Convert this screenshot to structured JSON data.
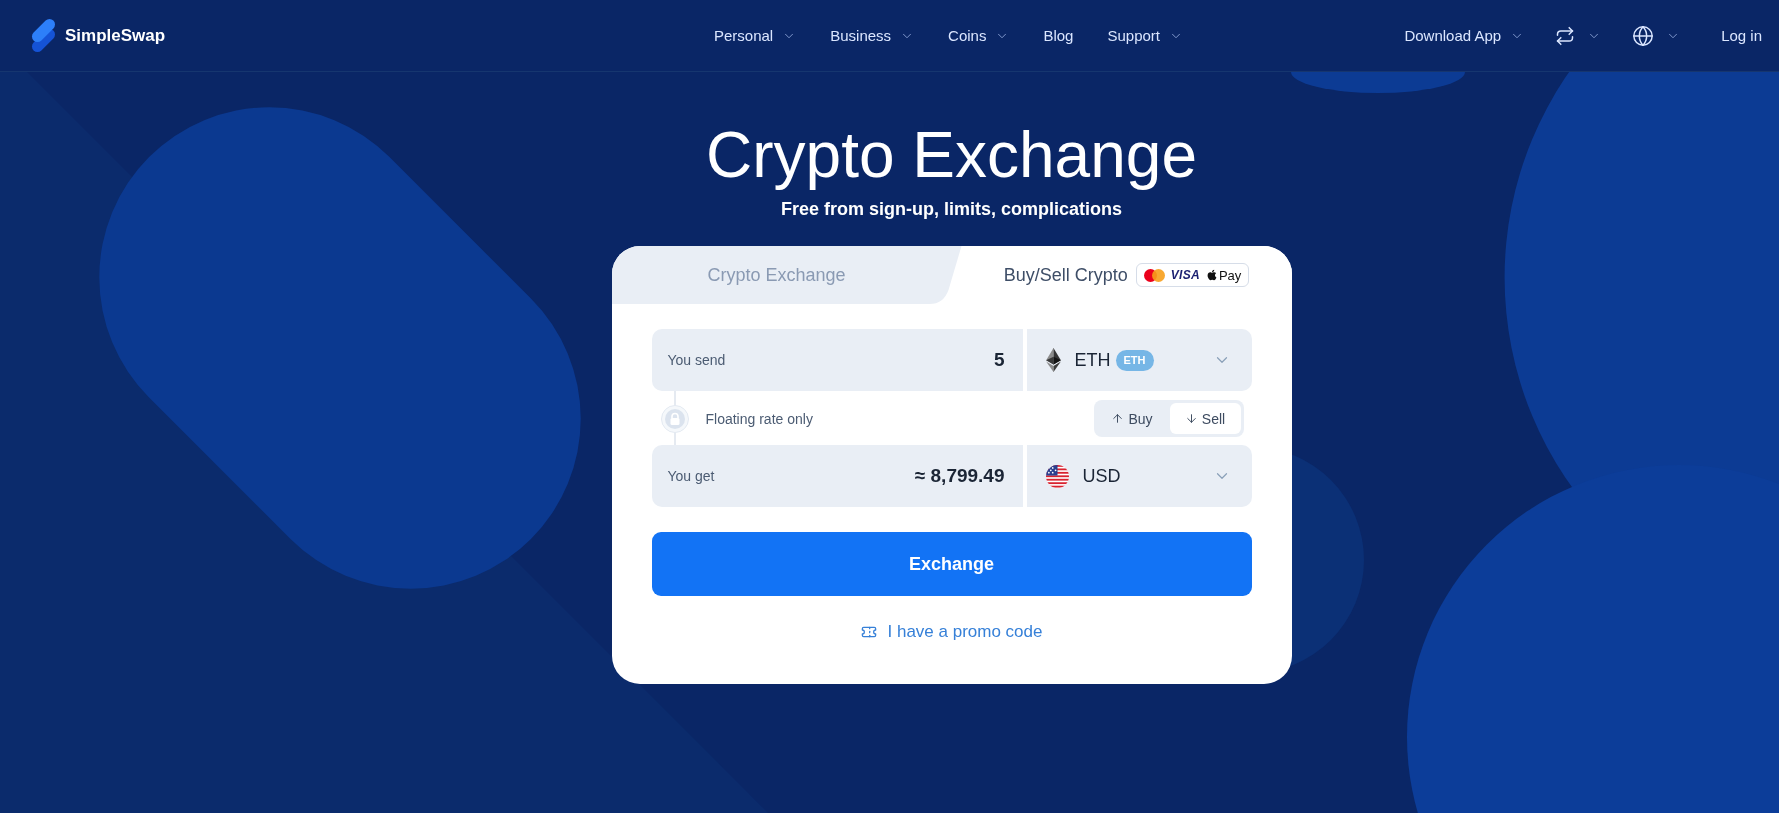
{
  "header": {
    "logo": "SimpleSwap",
    "nav": [
      {
        "label": "Personal",
        "has_menu": true
      },
      {
        "label": "Business",
        "has_menu": true
      },
      {
        "label": "Coins",
        "has_menu": true
      },
      {
        "label": "Blog",
        "has_menu": false
      },
      {
        "label": "Support",
        "has_menu": true
      }
    ],
    "download_app": "Download App",
    "login": "Log in"
  },
  "hero": {
    "title": "Crypto Exchange",
    "subtitle": "Free from sign-up, limits, complications"
  },
  "exchange_card": {
    "tabs": [
      {
        "label": "Crypto Exchange",
        "selected": false
      },
      {
        "label": "Buy/Sell Crypto",
        "selected": true,
        "payment_badge": {
          "visa": "VISA",
          "apple_pay": "Pay"
        }
      }
    ],
    "amounts": [
      {
        "kind": "crypto",
        "label": "You send",
        "value": "5",
        "currency": "ETH",
        "network": "ETH"
      },
      {
        "kind": "fiat",
        "label": "You get",
        "value": "≈ 8,799.49",
        "currency": "USD"
      }
    ],
    "rate_note": "Floating rate only",
    "direction": [
      {
        "kind": "buy",
        "label": "Buy",
        "selected": false
      },
      {
        "kind": "sell",
        "label": "Sell",
        "selected": true
      }
    ],
    "submit": "Exchange",
    "promo_link": "I have a promo code"
  }
}
